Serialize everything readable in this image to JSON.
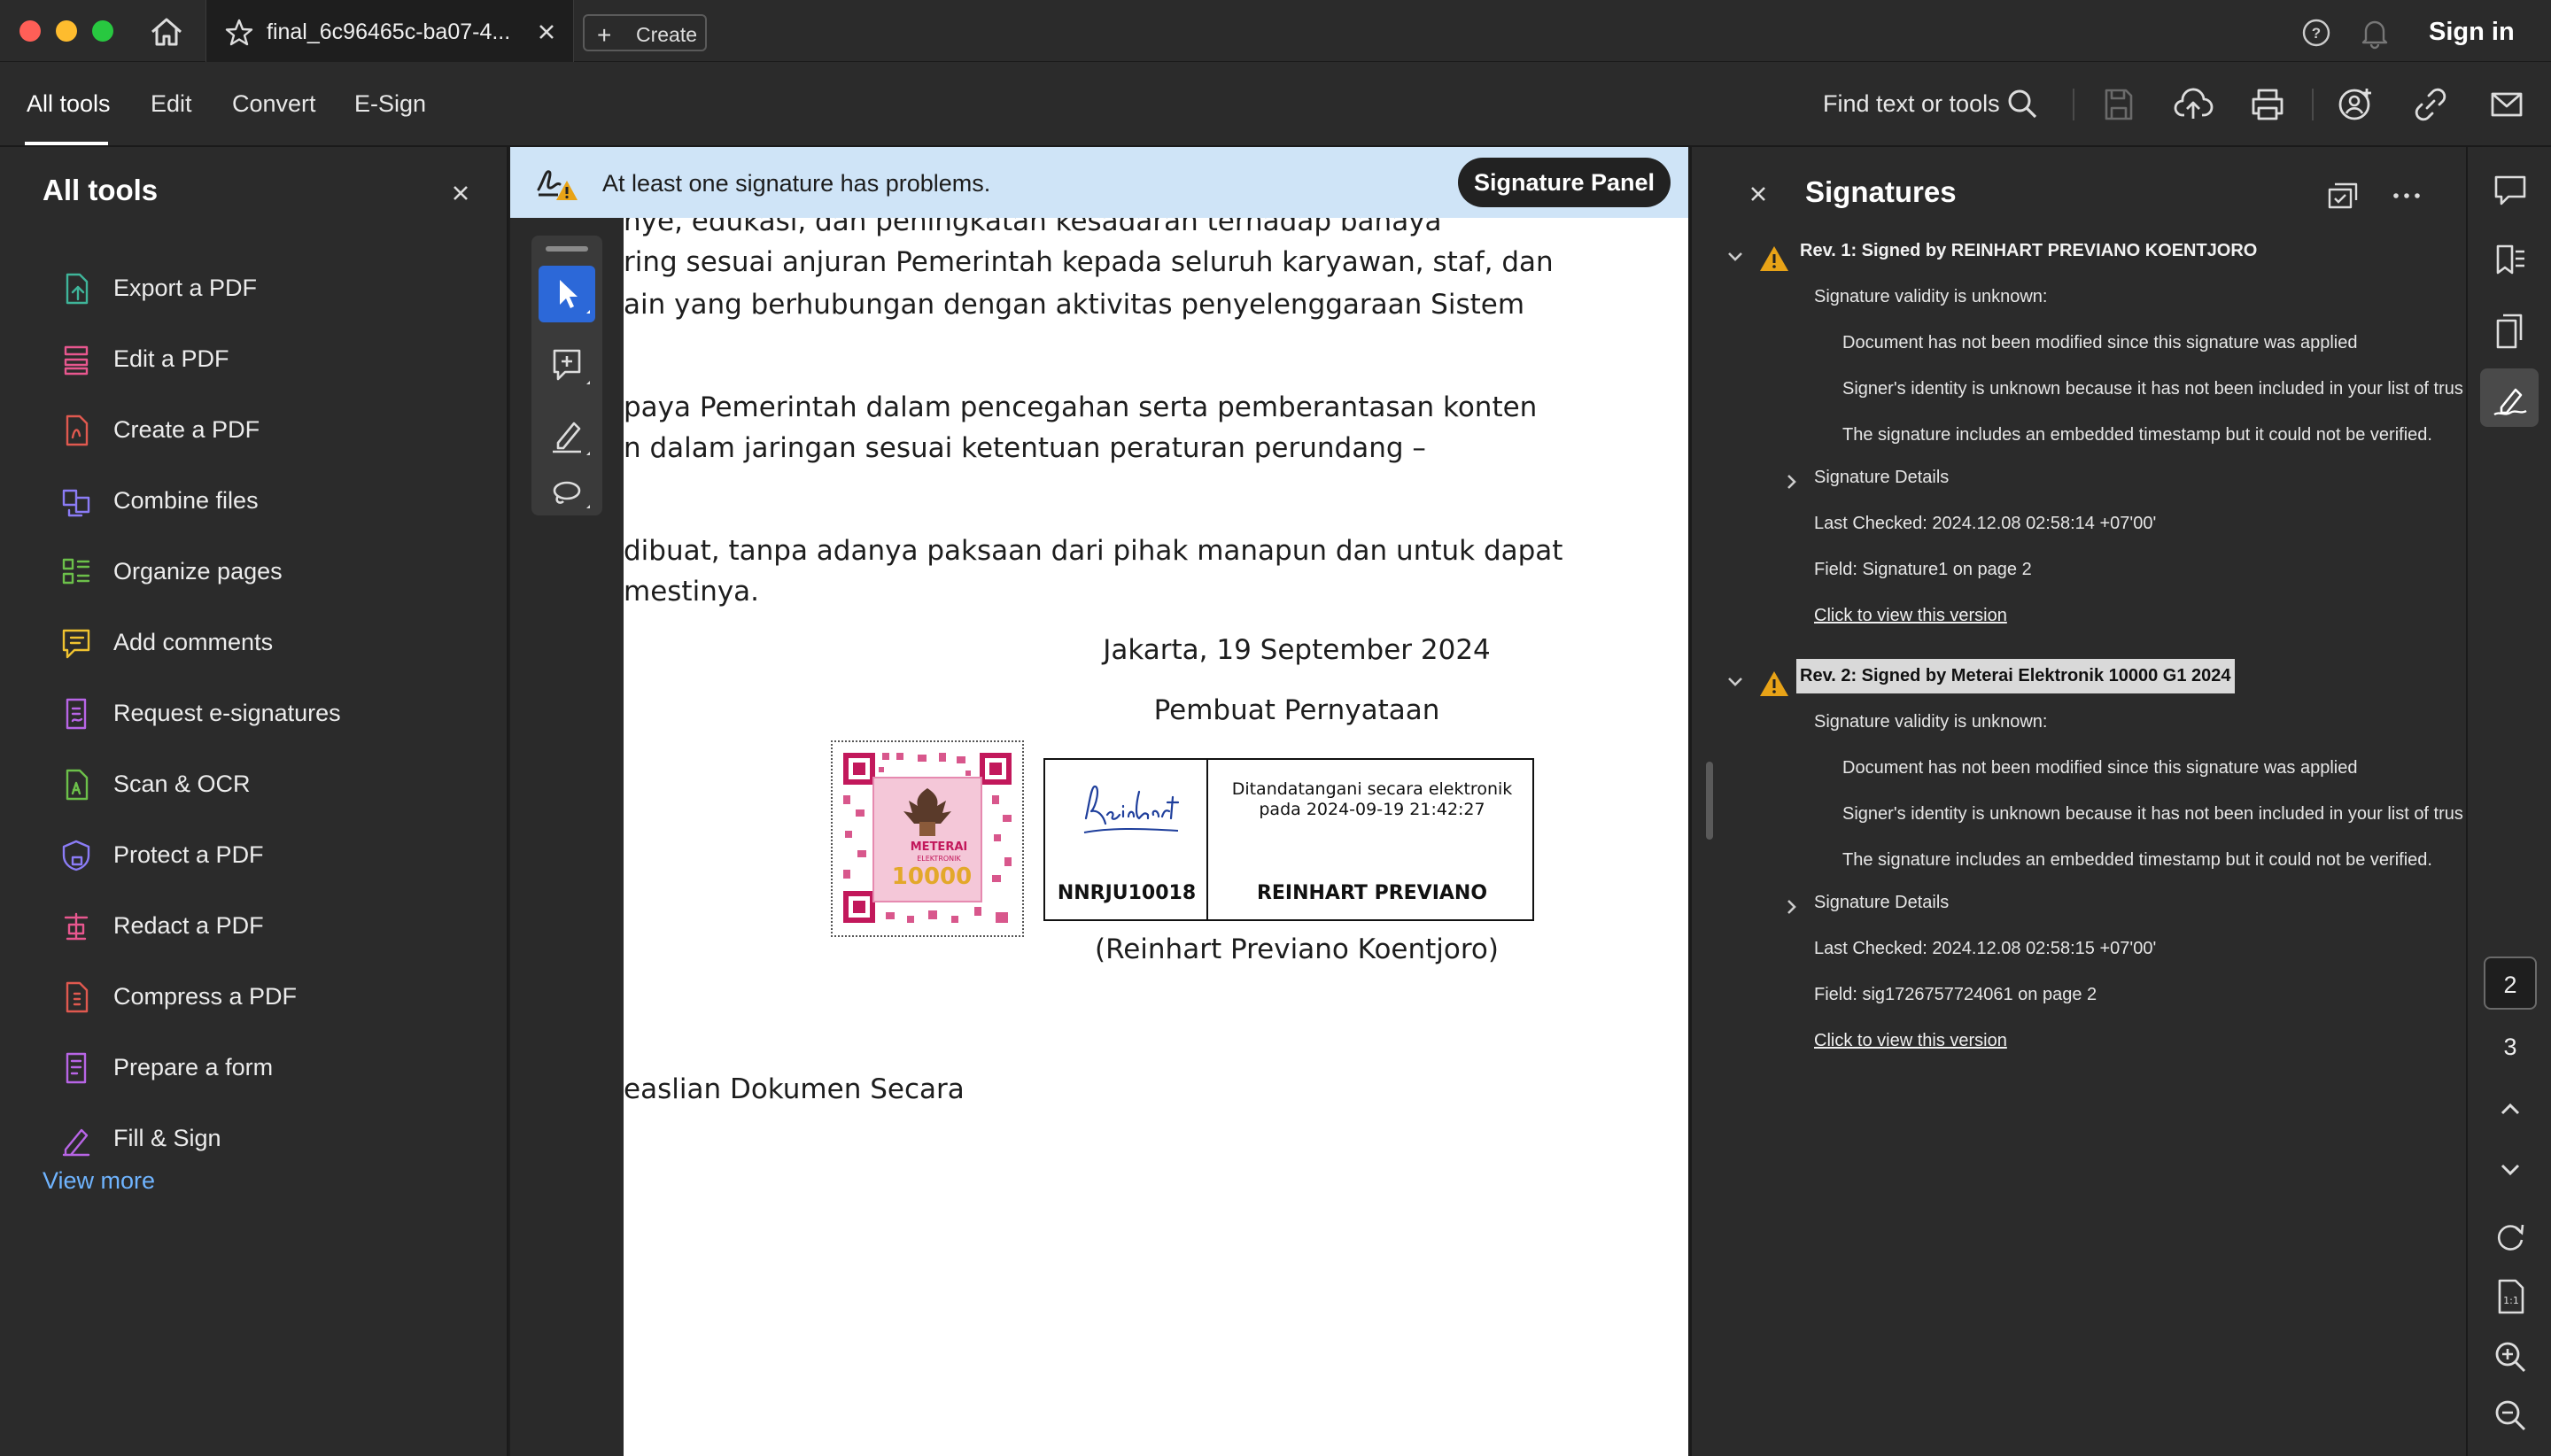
{
  "titlebar": {
    "tab_title": "final_6c96465c-ba07-4...",
    "create_label": "Create",
    "sign_in": "Sign in"
  },
  "menubar": {
    "tabs": [
      "All tools",
      "Edit",
      "Convert",
      "E-Sign"
    ],
    "active_tab": "All tools",
    "find_label": "Find text or tools"
  },
  "all_tools": {
    "title": "All tools",
    "items": [
      {
        "label": "Export a PDF",
        "icon": "export-pdf-icon",
        "color": "#3fb59a"
      },
      {
        "label": "Edit a PDF",
        "icon": "edit-pdf-icon",
        "color": "#e8578f"
      },
      {
        "label": "Create a PDF",
        "icon": "create-pdf-icon",
        "color": "#e0594f"
      },
      {
        "label": "Combine files",
        "icon": "combine-files-icon",
        "color": "#8b7cf6"
      },
      {
        "label": "Organize pages",
        "icon": "organize-pages-icon",
        "color": "#6cc04a"
      },
      {
        "label": "Add comments",
        "icon": "add-comments-icon",
        "color": "#f0c330"
      },
      {
        "label": "Request e-signatures",
        "icon": "request-esign-icon",
        "color": "#b865e6"
      },
      {
        "label": "Scan & OCR",
        "icon": "scan-ocr-icon",
        "color": "#6cc04a"
      },
      {
        "label": "Protect a PDF",
        "icon": "protect-pdf-icon",
        "color": "#8b7cf6"
      },
      {
        "label": "Redact a PDF",
        "icon": "redact-pdf-icon",
        "color": "#e8578f"
      },
      {
        "label": "Compress a PDF",
        "icon": "compress-pdf-icon",
        "color": "#e0594f"
      },
      {
        "label": "Prepare a form",
        "icon": "prepare-form-icon",
        "color": "#b865e6"
      },
      {
        "label": "Fill & Sign",
        "icon": "fill-sign-icon",
        "color": "#b865e6"
      }
    ],
    "view_more": "View more"
  },
  "signature_bar": {
    "message": "At least one signature has problems.",
    "button": "Signature Panel"
  },
  "document": {
    "lines": [
      "nye, edukasi, dan peningkatan kesadaran terhadap bahaya",
      "ring sesuai anjuran Pemerintah kepada seluruh karyawan, staf, dan",
      "ain yang berhubungan dengan aktivitas penyelenggaraan Sistem",
      "paya Pemerintah dalam pencegahan serta pemberantasan konten",
      "n dalam jaringan sesuai ketentuan peraturan perundang –",
      "dibuat, tanpa adanya paksaan dari pihak manapun dan untuk dapat",
      "mestinya."
    ],
    "place_date": "Jakarta, 19 September 2024",
    "maker_label": "Pembuat Pernyataan",
    "stamp": {
      "note_line1": "Ditandatangani secara elektronik",
      "note_line2": "pada 2024-09-19 21:42:27",
      "signer_id": "NNRJU10018",
      "signer_name": "REINHART PREVIANO"
    },
    "meterai": {
      "word": "METERAI",
      "sub": "ELEKTRONIK",
      "value": "10000"
    },
    "signer_full": "(Reinhart Previano Koentjoro)",
    "footer_line": "easlian Dokumen Secara"
  },
  "signatures_panel": {
    "title": "Signatures",
    "revisions": [
      {
        "title": "Rev. 1: Signed by REINHART PREVIANO KOENTJORO",
        "validity": "Signature validity is unknown:",
        "not_modified": "Document has not been modified since this signature was applied",
        "identity": "Signer's identity is unknown because it has not been included in your list of trus",
        "timestamp": "The signature includes an embedded timestamp but it could not be verified.",
        "details": "Signature Details",
        "last_checked": "Last Checked: 2024.12.08 02:58:14 +07'00'",
        "field": "Field: Signature1 on page 2",
        "view_version": "Click to view this version"
      },
      {
        "title": "Rev. 2: Signed by Meterai Elektronik 10000 G1 2024",
        "validity": "Signature validity is unknown:",
        "not_modified": "Document has not been modified since this signature was applied",
        "identity": "Signer's identity is unknown because it has not been included in your list of trus",
        "timestamp": "The signature includes an embedded timestamp but it could not be verified.",
        "details": "Signature Details",
        "last_checked": "Last Checked: 2024.12.08 02:58:15 +07'00'",
        "field": "Field: sig1726757724061 on page 2",
        "view_version": "Click to view this version"
      }
    ]
  },
  "rail": {
    "pages": [
      "2",
      "3"
    ],
    "current_page": "2"
  }
}
